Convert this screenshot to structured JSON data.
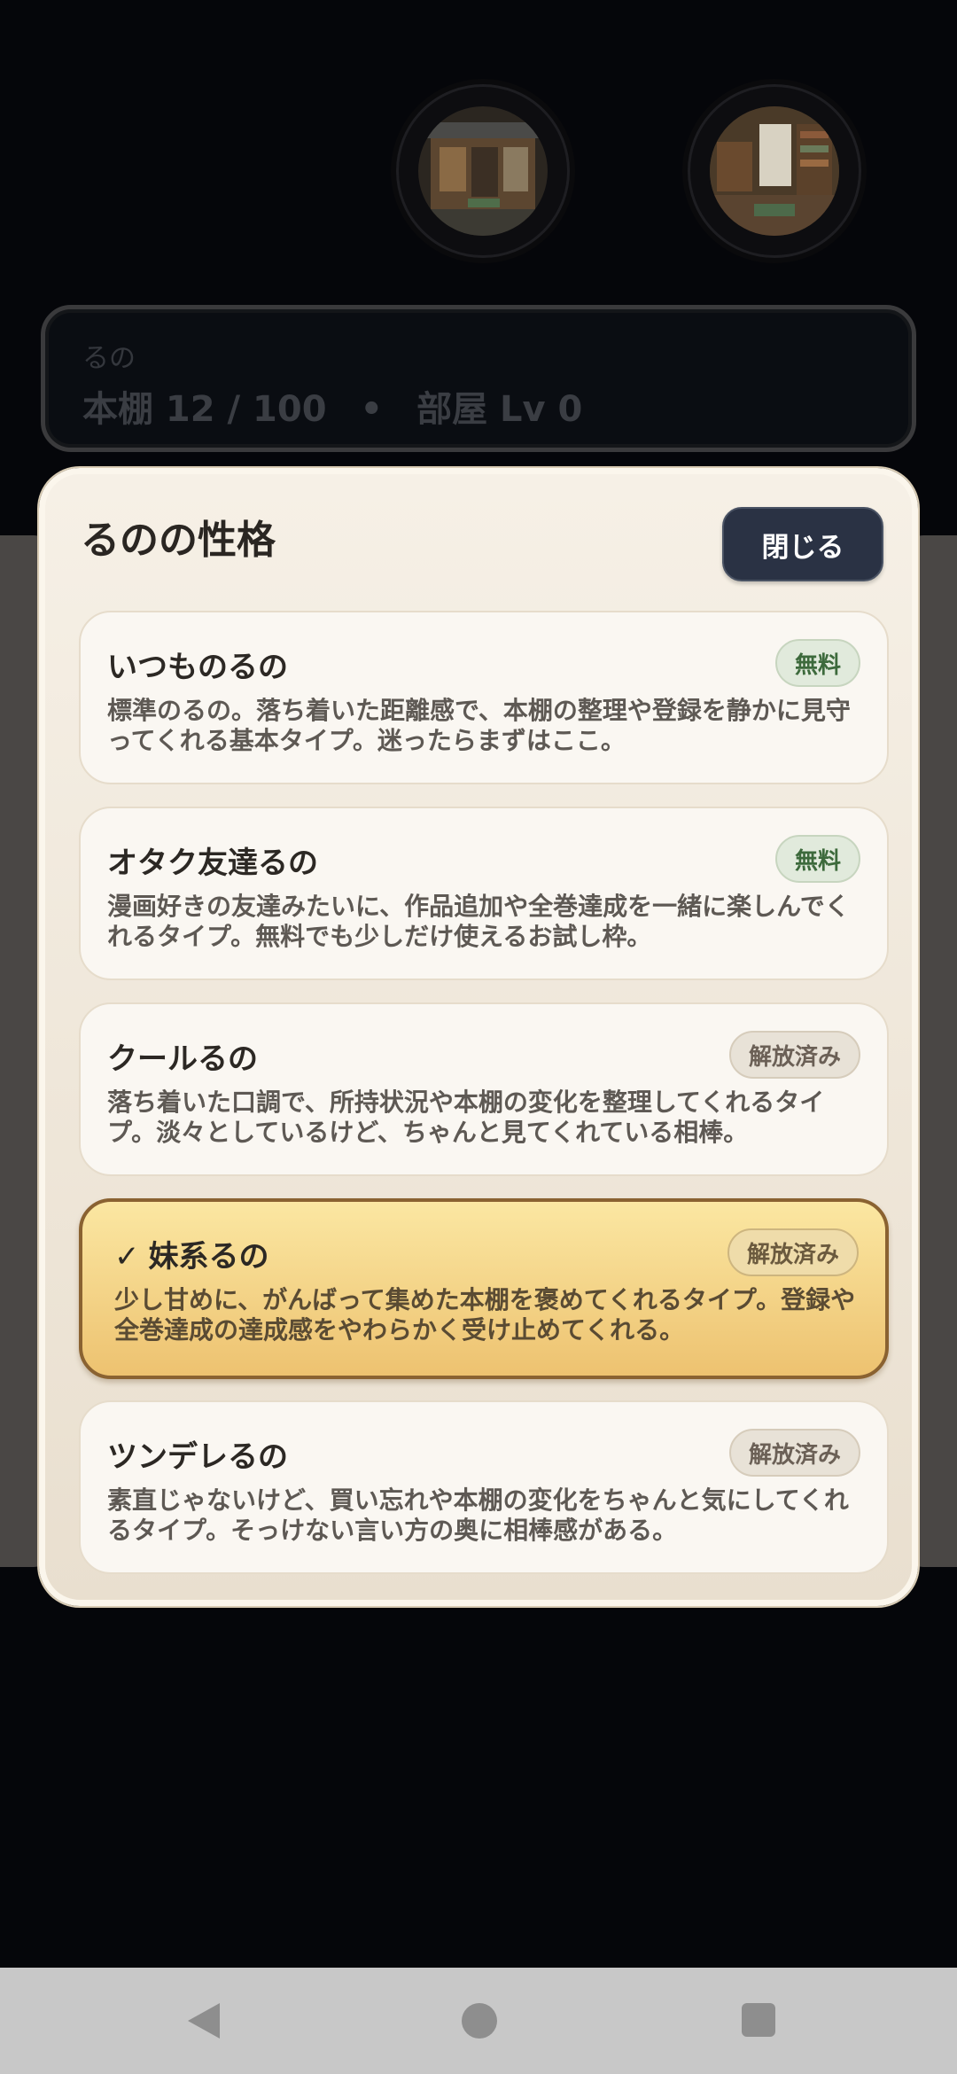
{
  "status": {
    "name": "るの",
    "bookshelf": "本棚 12 / 100",
    "separator": "•",
    "room_level": "部屋 Lv 0"
  },
  "modal": {
    "title": "るのの性格",
    "close_label": "閉じる",
    "options": [
      {
        "title": "いつものるの",
        "badge": "無料",
        "desc": "標準のるの。落ち着いた距離感で、本棚の整理や登録を静かに見守ってくれる基本タイプ。迷ったらまずはここ。"
      },
      {
        "title": "オタク友達るの",
        "badge": "無料",
        "desc": "漫画好きの友達みたいに、作品追加や全巻達成を一緒に楽しんでくれるタイプ。無料でも少しだけ使えるお試し枠。"
      },
      {
        "title": "クールるの",
        "badge": "解放済み",
        "desc": "落ち着いた口調で、所持状況や本棚の変化を整理してくれるタイプ。淡々としているけど、ちゃんと見てくれている相棒。"
      },
      {
        "title": "妹系るの",
        "check": "✓",
        "badge": "解放済み",
        "desc": "少し甘めに、がんばって集めた本棚を褒めてくれるタイプ。登録や全巻達成の達成感をやわらかく受け止めてくれる。"
      },
      {
        "title": "ツンデレるの",
        "badge": "解放済み",
        "desc": "素直じゃないけど、買い忘れや本棚の変化をちゃんと気にしてくれるタイプ。そっけない言い方の奥に相棒感がある。"
      }
    ]
  },
  "colors": {
    "background": "#05060a",
    "modal": "#f6f0e6",
    "selected_option": "#f3d184",
    "close_button": "#2a3244"
  },
  "icons": {
    "nav_back": "triangle-back-icon",
    "nav_home": "circle-home-icon",
    "nav_recent": "square-recent-icon"
  }
}
